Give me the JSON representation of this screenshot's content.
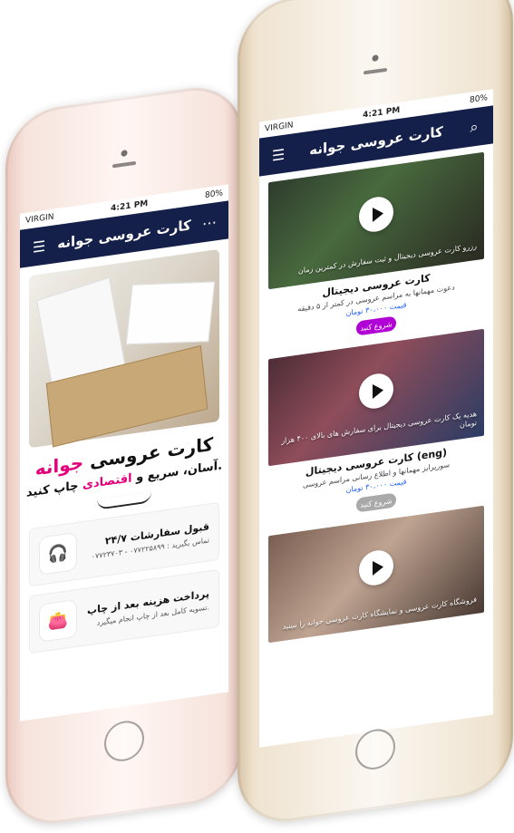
{
  "left_phone": {
    "status": {
      "carrier": "VIRGIN",
      "time": "4:21 PM",
      "battery": "80%"
    },
    "appbar": {
      "title": "کارت عروسی جوانه"
    },
    "hero": {
      "title_prefix": "کارت عروسی",
      "title_accent": "جوانه",
      "tagline_before": "آسان، سریع و",
      "tagline_accent": "اقتصادی",
      "tagline_after": "چاپ کنید."
    },
    "features": [
      {
        "title": "قبول سفارشات ۲۴/۷",
        "subtitle": "تماس بگیرید : ۰۷۷۲۲۵۸۹۹ - ۰۷۷۲۳۷۰۳"
      },
      {
        "title": "پرداخت هزینه بعد از چاپ",
        "subtitle": "تسویه کامل بعد از چاپ انجام میگیرد."
      }
    ]
  },
  "right_phone": {
    "status": {
      "carrier": "VIRGIN",
      "time": "4:21 PM",
      "battery": "80%"
    },
    "appbar": {
      "title": "کارت عروسی جوانه"
    },
    "items": [
      {
        "overlay": "رزرو کارت عروسی دیجیتال\nو ثبت سفارش در کمترین زمان",
        "name": "کارت عروسی دیجیتال",
        "desc": "دعوت مهمانها به مراسم عروسی در کمتر از ۵ دقیقه",
        "price": "قیمت ۳۰،۰۰۰ تومان",
        "button": "شروع کنید",
        "button_state": "active"
      },
      {
        "overlay": "هدیه یک کارت عروسی دیجیتال برای سفارش های\nبالای ۴۰۰ هزار تومان",
        "name": "کارت عروسی دیجیتال (eng)",
        "desc": "سورپرایز مهمانها و اطلاع رسانی مراسم عروسی",
        "price": "قیمت ۳۰،۰۰۰ تومان",
        "button": "شروع کنید",
        "button_state": "disabled"
      },
      {
        "overlay": "فروشگاه کارت عروسی و نمایشگاه کارت عروسی\nجوانه را ببینید",
        "name": "",
        "desc": "",
        "price": "",
        "button": "",
        "button_state": ""
      }
    ]
  }
}
